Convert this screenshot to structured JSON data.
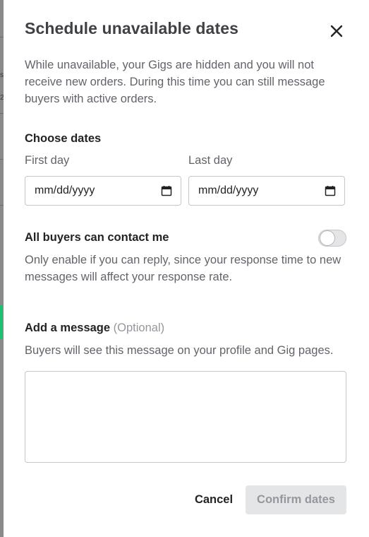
{
  "modal": {
    "title": "Schedule unavailable dates",
    "intro": "While unavailable, your Gigs are hidden and you will not receive new orders. During this time you can still message buyers with active orders."
  },
  "dates": {
    "section_title": "Choose dates",
    "first_day": {
      "label": "First day",
      "placeholder": "mm/dd/yyyy"
    },
    "last_day": {
      "label": "Last day",
      "placeholder": "mm/dd/yyyy"
    }
  },
  "contact": {
    "title": "All buyers can contact me",
    "description": "Only enable if you can reply, since your response time to new messages will affect your response rate.",
    "enabled": false
  },
  "message": {
    "title": "Add a message",
    "optional_label": "(Optional)",
    "description": "Buyers will see this message on your profile and Gig pages.",
    "value": ""
  },
  "actions": {
    "cancel_label": "Cancel",
    "confirm_label": "Confirm dates"
  },
  "icons": {
    "close": "close-icon",
    "calendar": "calendar-icon"
  },
  "colors": {
    "accent": "#1dbf73",
    "title": "#404145",
    "muted_text": "#62646a",
    "disabled_bg": "#e4e5e7",
    "disabled_text": "#95979d"
  }
}
